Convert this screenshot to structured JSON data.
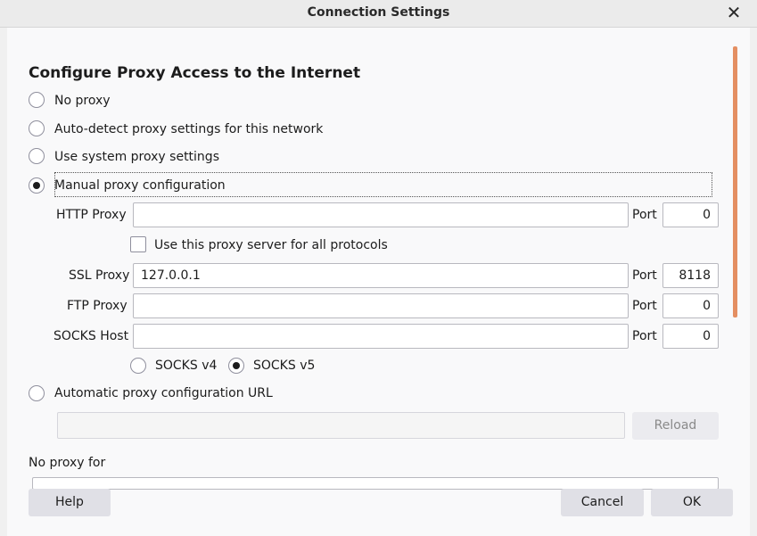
{
  "window": {
    "title": "Connection Settings",
    "close_icon": "close-icon"
  },
  "section_title": "Configure Proxy Access to the Internet",
  "proxy_mode": {
    "no_proxy": "No proxy",
    "auto_detect": "Auto-detect proxy settings for this network",
    "system": "Use system proxy settings",
    "manual": "Manual proxy configuration",
    "selected": "manual"
  },
  "manual": {
    "http_proxy": {
      "label": "HTTP Proxy",
      "value": "",
      "port_label": "Port",
      "port": "0"
    },
    "use_for_all": {
      "label": "Use this proxy server for all protocols",
      "checked": false
    },
    "ssl_proxy": {
      "label": "SSL Proxy",
      "value": "127.0.0.1",
      "port_label": "Port",
      "port": "8118"
    },
    "ftp_proxy": {
      "label": "FTP Proxy",
      "value": "",
      "port_label": "Port",
      "port": "0"
    },
    "socks_host": {
      "label": "SOCKS Host",
      "value": "",
      "port_label": "Port",
      "port": "0"
    },
    "socks_v4": "SOCKS v4",
    "socks_v5": "SOCKS v5",
    "socks_selected": "v5"
  },
  "auto_config": {
    "label": "Automatic proxy configuration URL",
    "url": "",
    "reload_label": "Reload"
  },
  "no_proxy_for": {
    "label": "No proxy for",
    "value": ""
  },
  "buttons": {
    "help": "Help",
    "cancel": "Cancel",
    "ok": "OK"
  },
  "colors": {
    "scrollbar_thumb": "#e48f62",
    "background": "#f9f9fa"
  }
}
